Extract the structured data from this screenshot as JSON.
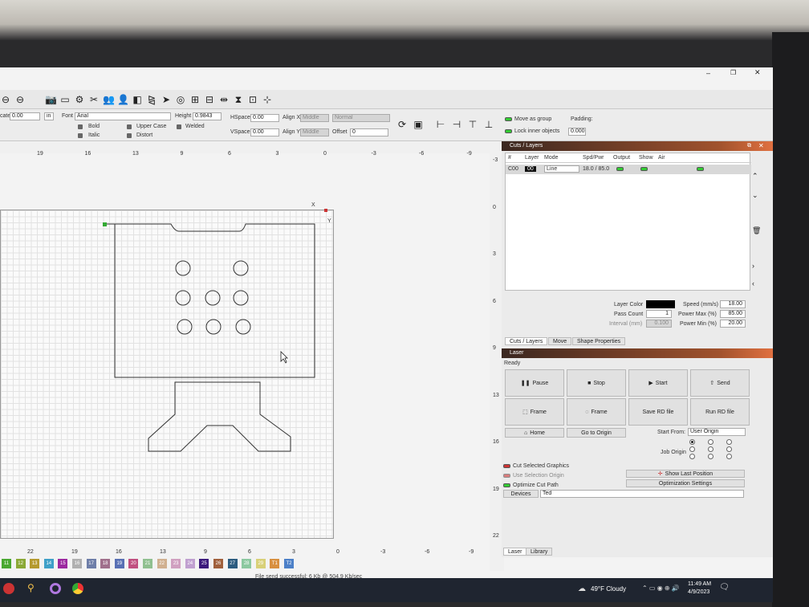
{
  "toolbar": {
    "icons": [
      "zoom-icon",
      "minus-icon",
      "camera-icon",
      "monitor-icon",
      "gear-icon",
      "tools-icon",
      "users-icon",
      "user-icon",
      "flip-icon",
      "mirror-icon",
      "send-icon",
      "target-icon",
      "align-icon",
      "array-icon",
      "dist-icon",
      "hcenter-icon",
      "size-icon",
      "move-icon"
    ]
  },
  "props": {
    "rotate_label": "cate",
    "rotate_value": "0.00",
    "rotate_unit": "in",
    "font_label": "Font",
    "font_value": "Arial",
    "height_label": "Height",
    "height_value": "0.9843",
    "bold": "Bold",
    "italic": "Italic",
    "upper": "Upper Case",
    "distort": "Distort",
    "welded": "Welded",
    "hspace_label": "HSpace",
    "hspace_value": "0.00",
    "vspace_label": "VSpace",
    "vspace_value": "0.00",
    "alignx_label": "Align X",
    "alignx_value": "Middle",
    "aligny_label": "Align Y",
    "aligny_value": "Middle",
    "normal_value": "Normal",
    "offset_label": "Offset",
    "offset_value": "0",
    "move_group": "Move as group",
    "lock_inner": "Lock inner objects",
    "padding_label": "Padding:",
    "padding_value": "0.000"
  },
  "rulers": {
    "top": [
      "19",
      "16",
      "13",
      "9",
      "6",
      "3",
      "0",
      "-3",
      "-6",
      "-9"
    ],
    "right": [
      "-3",
      "0",
      "3",
      "6",
      "9",
      "13",
      "16",
      "19",
      "22"
    ],
    "bottom": [
      "22",
      "19",
      "16",
      "13",
      "9",
      "6",
      "3",
      "0",
      "-3",
      "-6",
      "-9"
    ],
    "x_marker": "X",
    "y_marker": "Y"
  },
  "palette": [
    {
      "n": "11",
      "c": "#4aa832"
    },
    {
      "n": "12",
      "c": "#8aa836"
    },
    {
      "n": "13",
      "c": "#b59a2e"
    },
    {
      "n": "14",
      "c": "#3fa0c8"
    },
    {
      "n": "15",
      "c": "#9c2aa0"
    },
    {
      "n": "16",
      "c": "#b0b0b0"
    },
    {
      "n": "17",
      "c": "#6e7ea8"
    },
    {
      "n": "18",
      "c": "#a0708c"
    },
    {
      "n": "19",
      "c": "#5870b4"
    },
    {
      "n": "20",
      "c": "#c05080"
    },
    {
      "n": "21",
      "c": "#90c090"
    },
    {
      "n": "22",
      "c": "#d0b090"
    },
    {
      "n": "23",
      "c": "#d0a0c0"
    },
    {
      "n": "24",
      "c": "#c0a0d0"
    },
    {
      "n": "25",
      "c": "#3c1a7c"
    },
    {
      "n": "26",
      "c": "#a0603c"
    },
    {
      "n": "27",
      "c": "#2c5c80"
    },
    {
      "n": "28",
      "c": "#8cc8a0"
    },
    {
      "n": "29",
      "c": "#d8d078"
    },
    {
      "n": "T1",
      "c": "#d89040"
    },
    {
      "n": "T2",
      "c": "#4c80c8"
    }
  ],
  "status_text": "File send successful: 6 Kb @ 504.9 Kb/sec",
  "cuts": {
    "title": "Cuts / Layers",
    "headers": [
      "#",
      "Layer",
      "Mode",
      "Spd/Pwr",
      "Output",
      "Show",
      "Air"
    ],
    "rows": [
      {
        "num": "C00",
        "layer": "00",
        "mode": "Line",
        "spdpwr": "18.0 / 85.0"
      }
    ],
    "layer_color_label": "Layer Color",
    "pass_count_label": "Pass Count",
    "pass_count_value": "1",
    "interval_label": "Interval (mm)",
    "interval_value": "0.100",
    "speed_label": "Speed (mm/s)",
    "speed_value": "18.00",
    "powermax_label": "Power Max (%)",
    "powermax_value": "85.00",
    "powermin_label": "Power Min (%)",
    "powermin_value": "20.00",
    "tabs": [
      "Cuts / Layers",
      "Move",
      "Shape Properties"
    ]
  },
  "laser": {
    "title": "Laser",
    "status": "Ready",
    "pause": "Pause",
    "stop": "Stop",
    "start": "Start",
    "send": "Send",
    "frame": "Frame",
    "frame2": "Frame",
    "save_rd": "Save RD file",
    "run_rd": "Run RD file",
    "home": "Home",
    "goto_origin": "Go to Origin",
    "start_from_label": "Start From:",
    "start_from_value": "User Origin",
    "job_origin_label": "Job Origin",
    "cut_selected": "Cut Selected Graphics",
    "use_selection": "Use Selection Origin",
    "optimize": "Optimize Cut Path",
    "show_last": "Show Last Position",
    "opt_settings": "Optimization Settings",
    "devices": "Devices",
    "device_value": "Ted",
    "tabs": [
      "Laser",
      "Library"
    ]
  },
  "taskbar": {
    "weather": "49°F  Cloudy",
    "time": "11:49 AM",
    "date": "4/9/2023"
  }
}
